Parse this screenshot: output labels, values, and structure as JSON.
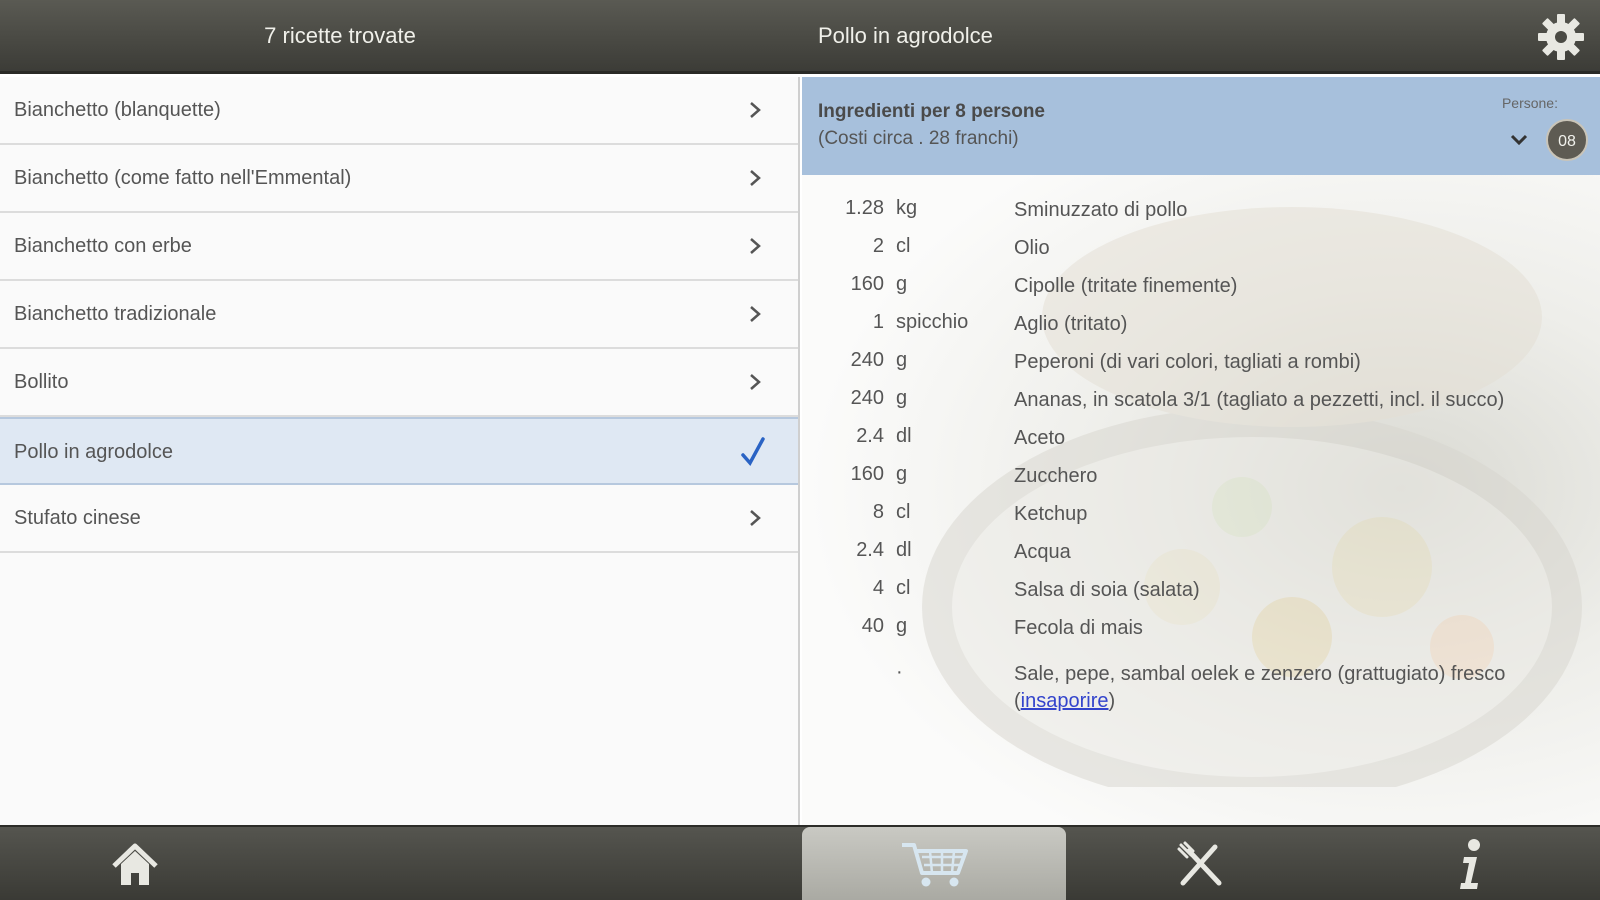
{
  "left_header": {
    "title": "7 ricette trovate"
  },
  "right_header": {
    "title": "Pollo in agrodolce"
  },
  "recipes": [
    {
      "label": "Bianchetto (blanquette)",
      "selected": false
    },
    {
      "label": "Bianchetto (come fatto nell'Emmental)",
      "selected": false
    },
    {
      "label": "Bianchetto con erbe",
      "selected": false
    },
    {
      "label": "Bianchetto tradizionale",
      "selected": false
    },
    {
      "label": "Bollito",
      "selected": false
    },
    {
      "label": "Pollo in agrodolce",
      "selected": true
    },
    {
      "label": "Stufato cinese",
      "selected": false
    }
  ],
  "detail": {
    "heading": "Ingredienti per 8 persone",
    "cost": "(Costi circa . 28 franchi)",
    "persons_label": "Persone:",
    "persons_value": "08",
    "ingredients": [
      {
        "qty": "1.28",
        "unit": "kg",
        "name": "Sminuzzato di pollo"
      },
      {
        "qty": "2",
        "unit": "cl",
        "name": "Olio"
      },
      {
        "qty": "160",
        "unit": "g",
        "name": "Cipolle (tritate finemente)"
      },
      {
        "qty": "1",
        "unit": "spicchio",
        "name": "Aglio (tritato)"
      },
      {
        "qty": "240",
        "unit": "g",
        "name": "Peperoni (di vari colori, tagliati a rombi)"
      },
      {
        "qty": "240",
        "unit": "g",
        "name": "Ananas, in scatola 3/1 (tagliato a pezzetti, incl. il succo)"
      },
      {
        "qty": "2.4",
        "unit": "dl",
        "name": "Aceto"
      },
      {
        "qty": "160",
        "unit": "g",
        "name": "Zucchero"
      },
      {
        "qty": "8",
        "unit": "cl",
        "name": "Ketchup"
      },
      {
        "qty": "2.4",
        "unit": "dl",
        "name": "Acqua"
      },
      {
        "qty": "4",
        "unit": "cl",
        "name": "Salsa di soia (salata)"
      },
      {
        "qty": "40",
        "unit": "g",
        "name": "Fecola di mais"
      }
    ],
    "last_ingredient": {
      "bullet": "·",
      "text": "Sale, pepe, sambal oelek e zenzero (grattugiato) fresco",
      "link_open": "(",
      "link": "insaporire",
      "link_close": ")"
    }
  },
  "bottom_nav": [
    {
      "icon": "home-icon",
      "active": false
    },
    {
      "icon": "cart-icon",
      "active": true
    },
    {
      "icon": "cutlery-icon",
      "active": false
    },
    {
      "icon": "info-icon",
      "active": false
    }
  ],
  "colors": {
    "topbar": "#4a4a44",
    "selected_row": "#dfe8f3",
    "detail_header": "#a7c0dc",
    "check": "#2a63c4",
    "link": "#3344cc"
  }
}
